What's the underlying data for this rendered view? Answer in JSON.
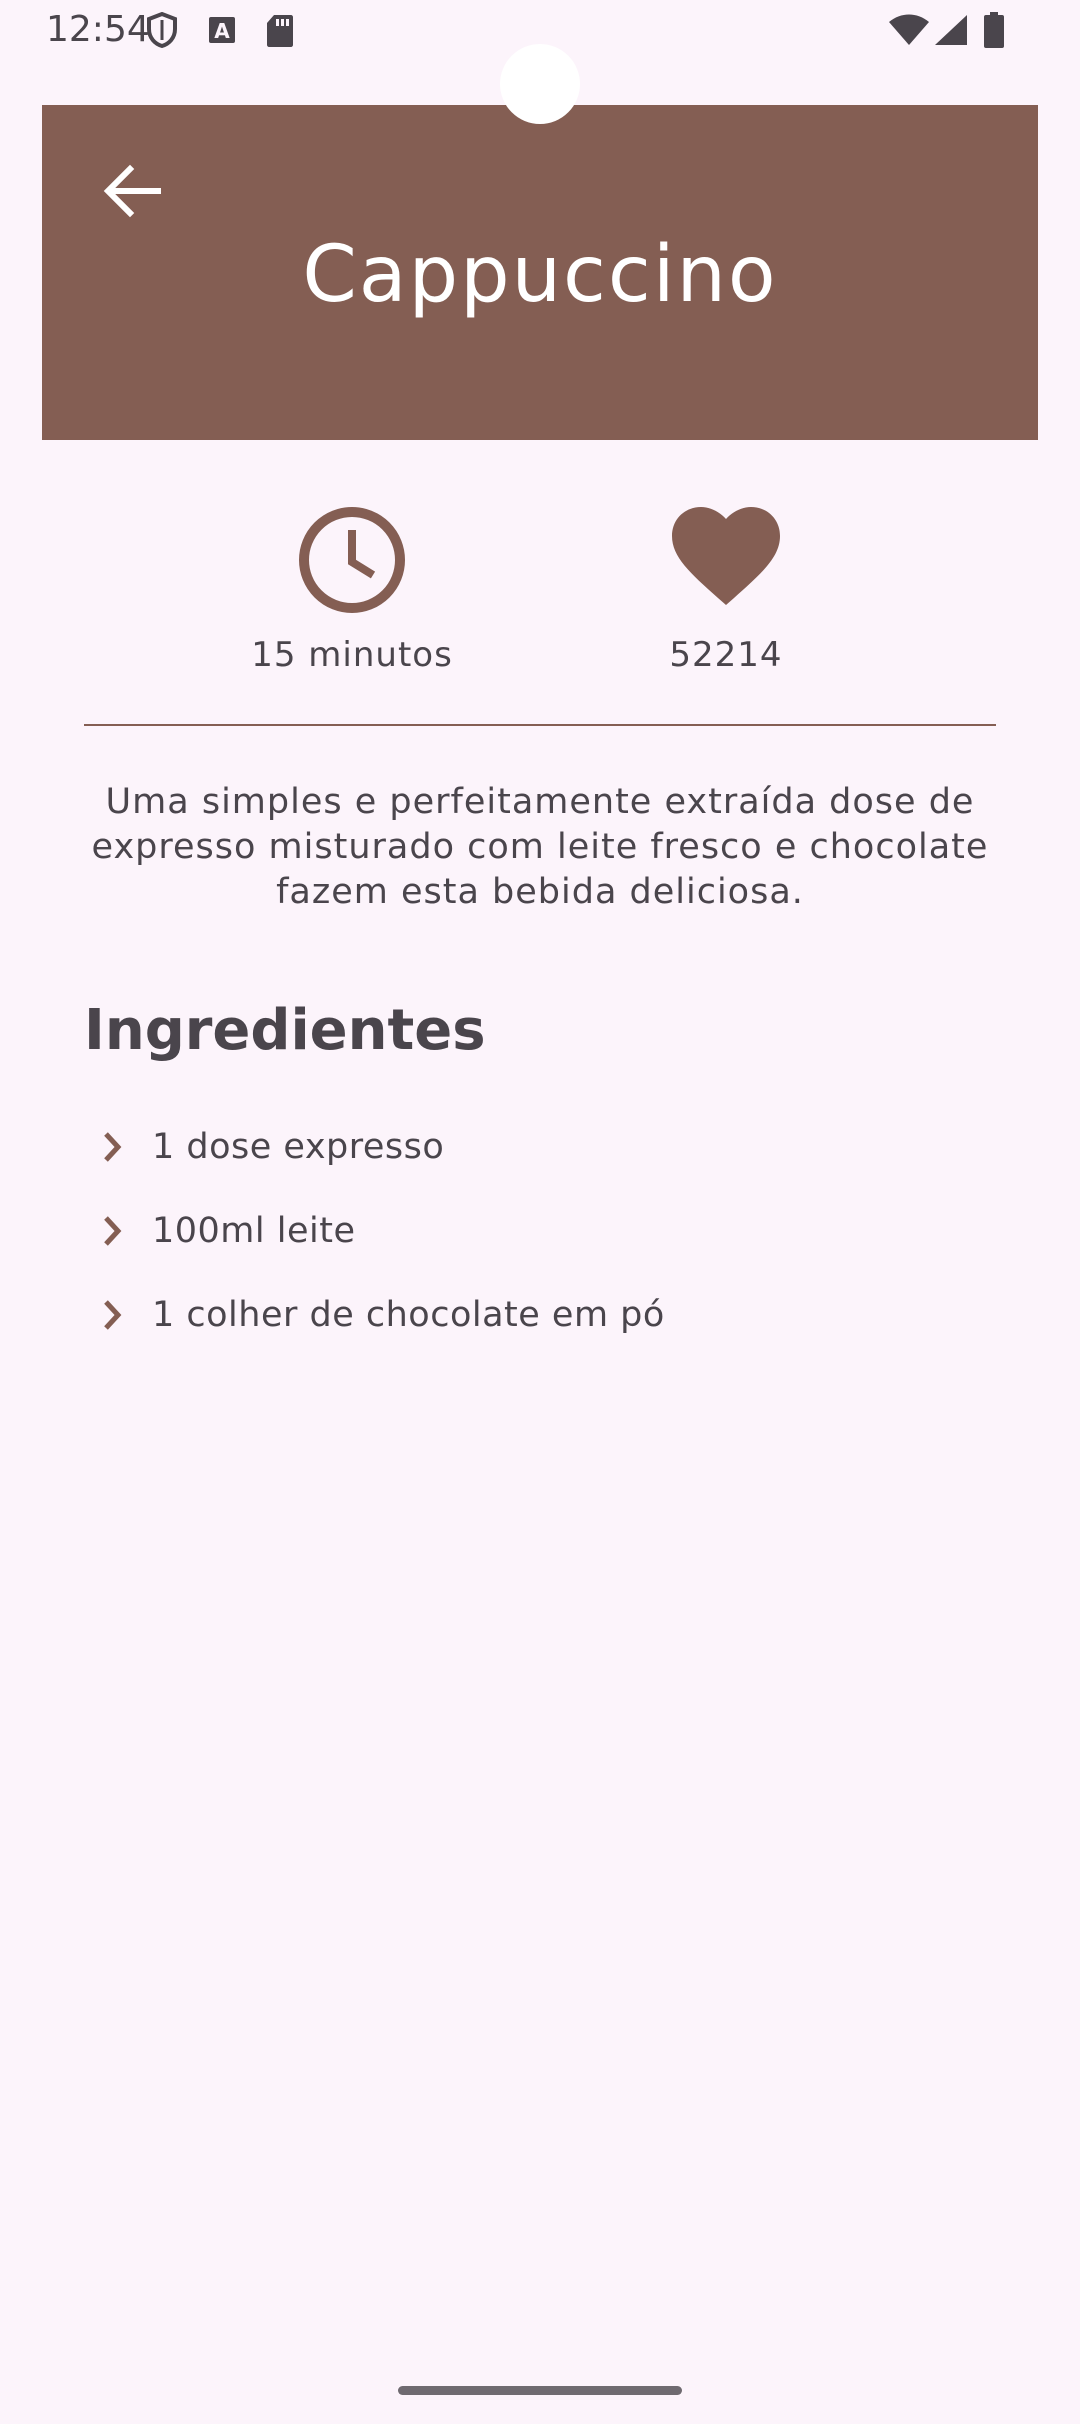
{
  "status_bar": {
    "time": "12:54",
    "left_icons": [
      "shield-icon",
      "font-a-icon",
      "sd-card-icon"
    ],
    "right_icons": [
      "wifi-icon",
      "signal-icon",
      "battery-icon"
    ]
  },
  "header": {
    "back_icon": "arrow-left-icon",
    "title": "Cappuccino",
    "background_color": "#845e53"
  },
  "stats": {
    "time": {
      "icon": "clock-icon",
      "label": "15 minutos"
    },
    "likes": {
      "icon": "heart-icon",
      "label": "52214"
    }
  },
  "description": "Uma simples e perfeitamente extraída dose de expresso misturado com leite fresco e chocolate fazem esta bebida deliciosa.",
  "ingredients": {
    "title": "Ingredientes",
    "bullet_icon": "chevron-right-icon",
    "items": [
      "1 dose expresso",
      "100ml leite",
      "1 colher de chocolate em pó"
    ]
  },
  "colors": {
    "accent": "#845e53",
    "background": "#fcf4fb",
    "text": "#4a454c"
  }
}
